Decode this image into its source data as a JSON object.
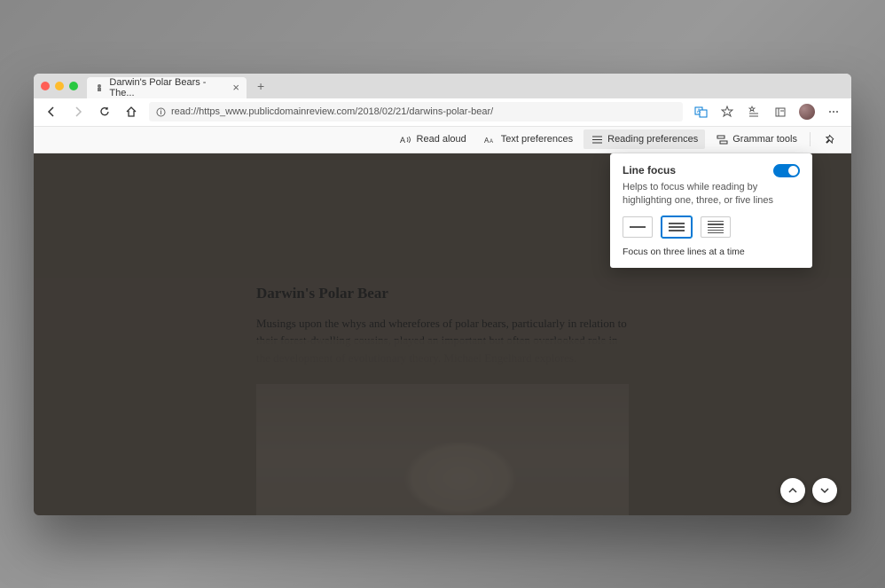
{
  "tab": {
    "title": "Darwin's Polar Bears - The..."
  },
  "address": {
    "url": "read://https_www.publicdomainreview.com/2018/02/21/darwins-polar-bear/"
  },
  "reader_toolbar": {
    "read_aloud": "Read aloud",
    "text_prefs": "Text preferences",
    "reading_prefs": "Reading preferences",
    "grammar": "Grammar tools"
  },
  "popup": {
    "title": "Line focus",
    "description": "Helps to focus while reading by highlighting one, three, or five lines",
    "caption": "Focus on three lines at a time"
  },
  "article": {
    "heading": "Darwin's Polar Bear",
    "body": "Musings upon the whys and wherefores of polar bears, particularly in relation to their forest-dwelling cousins, played an important but often overlooked role in the development of evolutionary theory. Michael Engelhard explores."
  }
}
